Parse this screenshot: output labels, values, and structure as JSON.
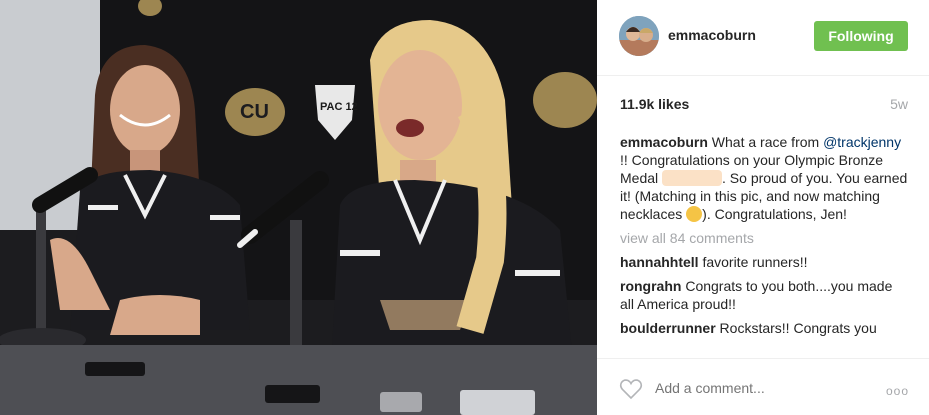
{
  "header": {
    "username": "emmacoburn",
    "follow_label": "Following"
  },
  "stats": {
    "likes": "11.9k likes",
    "age": "5w"
  },
  "caption": {
    "user": "emmacoburn",
    "text_1": " What a race from ",
    "mention": "@trackjenny",
    "text_2": " !! Congratulations on your Olympic Bronze Medal ",
    "text_3": ". So proud of you. You earned it! (Matching in this pic, and now matching necklaces ",
    "text_4": "). Congratulations, Jen!"
  },
  "view_all": "view all 84 comments",
  "comments": [
    {
      "user": "hannahhtell",
      "text": " favorite runners!!"
    },
    {
      "user": "rongrahn",
      "text": " Congrats to you both....you made all America proud!!"
    },
    {
      "user": "boulderrunner",
      "text": " Rockstars!! Congrats you"
    }
  ],
  "footer": {
    "comment_placeholder": "Add a comment...",
    "more_label": "ooo"
  },
  "photo": {
    "banner_logo": "CU",
    "pac_logo": "PAC 12"
  },
  "colors": {
    "follow_green": "#70c050",
    "mention_blue": "#003569",
    "muted_gray": "#a5a7aa"
  }
}
